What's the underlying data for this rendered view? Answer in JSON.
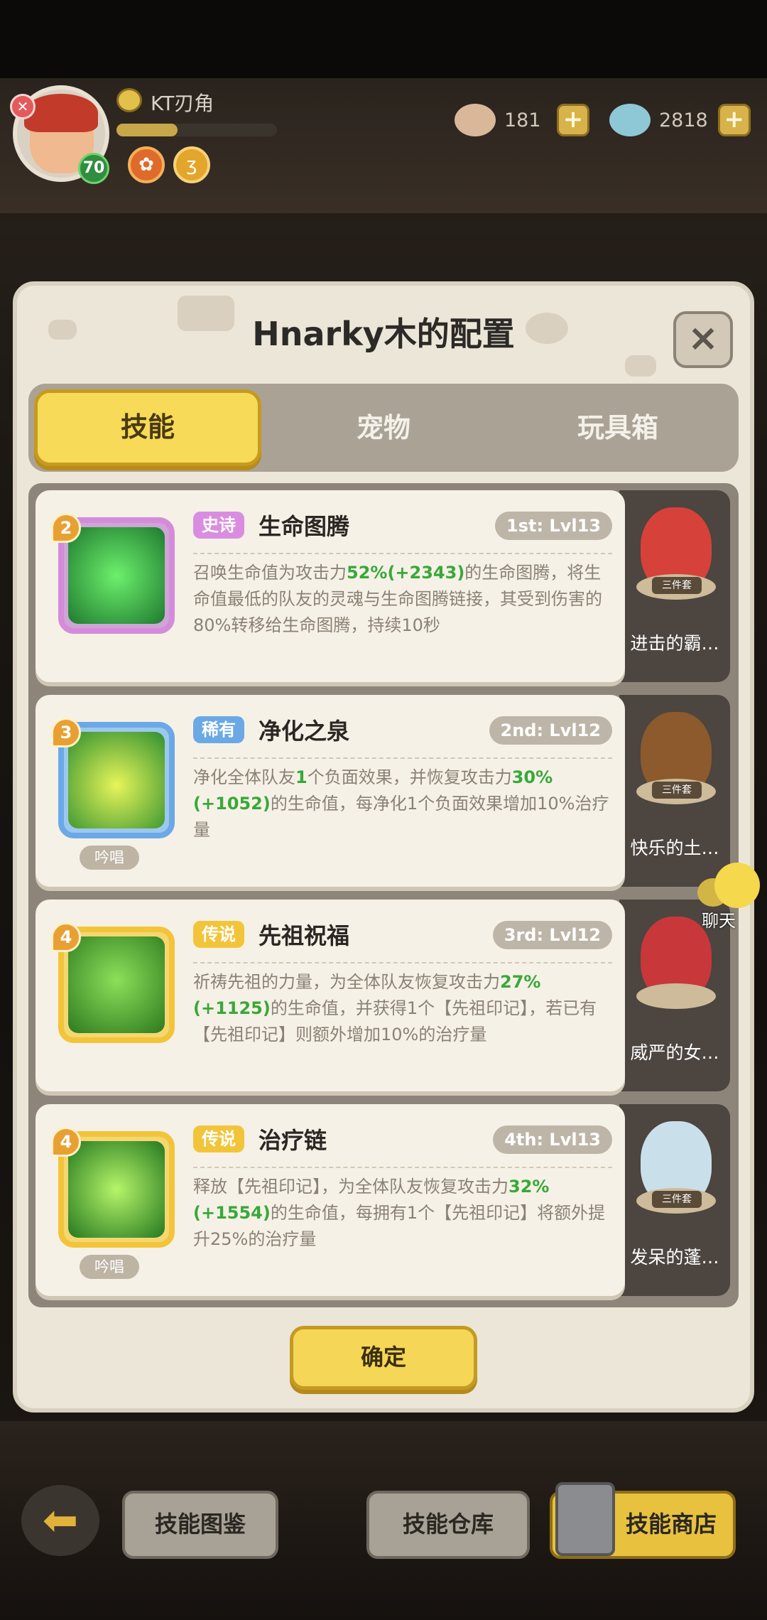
{
  "player": {
    "name": "KT刃角",
    "level": "70",
    "xp_fraction": 0.38
  },
  "currencies": [
    {
      "icon": "seashell-icon",
      "value": "181"
    },
    {
      "icon": "clam-icon",
      "value": "2818"
    }
  ],
  "panel": {
    "title": "Hnarky木的配置",
    "close_label": "×",
    "tabs": [
      {
        "label": "技能",
        "active": true
      },
      {
        "label": "宠物",
        "active": false
      },
      {
        "label": "玩具箱",
        "active": false
      }
    ],
    "confirm_label": "确定"
  },
  "skills": [
    {
      "badge": "2",
      "rarity": "史诗",
      "name": "生命图腾",
      "slot": "1st: Lvl13",
      "chant": "",
      "desc": [
        "召唤生命值为攻击力",
        "52%(+2343)",
        "的生命图腾，将生命值最低的队友的灵魂与生命图腾链接，其受到伤害的80%转移给生命图腾，持续10秒"
      ],
      "pet_name": "进击的霸…",
      "pet_tag": "三件套"
    },
    {
      "badge": "3",
      "rarity": "稀有",
      "name": "净化之泉",
      "slot": "2nd: Lvl12",
      "chant": "吟唱",
      "desc": [
        "净化全体队友",
        "1",
        "个负面效果，并恢复攻击力",
        "30%(+1052)",
        "的生命值，每净化1个负面效果增加10%治疗量"
      ],
      "pet_name": "快乐的土…",
      "pet_tag": "三件套"
    },
    {
      "badge": "4",
      "rarity": "传说",
      "name": "先祖祝福",
      "slot": "3rd: Lvl12",
      "chant": "",
      "desc": [
        "祈祷先祖的力量，为全体队友恢复攻击力",
        "27%(+1125)",
        "的生命值，并获得1个【先祖印记】，若已有【先祖印记】则额外增加10%的治疗量"
      ],
      "pet_name": "威严的女…",
      "pet_tag": ""
    },
    {
      "badge": "4",
      "rarity": "传说",
      "name": "治疗链",
      "slot": "4th: Lvl13",
      "chant": "吟唱",
      "desc": [
        "释放【先祖印记】，为全体队友恢复攻击力",
        "32%(+1554)",
        "的生命值，每拥有1个【先祖印记】将额外提升25%的治疗量"
      ],
      "pet_name": "发呆的蓬…",
      "pet_tag": "三件套"
    }
  ],
  "chat_label": "聊天",
  "bottom_bar": {
    "back_label": "⬅",
    "codex_label": "技能图鉴",
    "warehouse_label": "技能仓库",
    "shop_label": "技能商店"
  },
  "colors": {
    "epic": "#d98de0",
    "rare": "#6aa9e6",
    "legend": "#f2c43a",
    "highlight": "#39a83a"
  }
}
